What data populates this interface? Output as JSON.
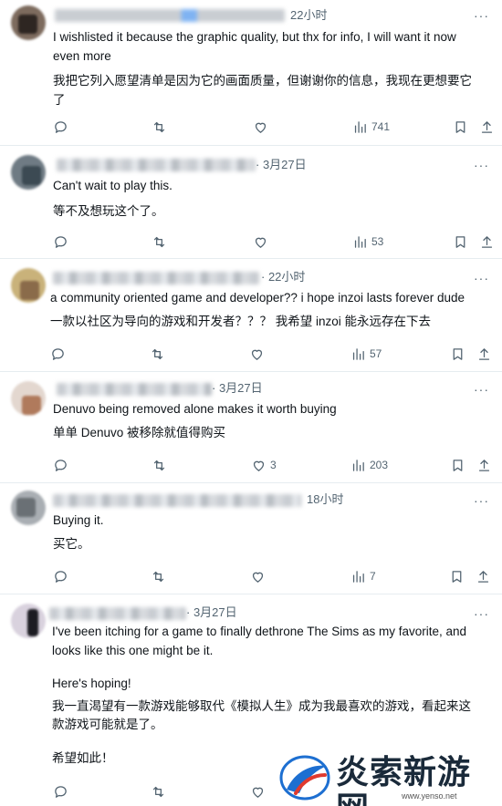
{
  "posts": [
    {
      "time": "22小时",
      "lines": [
        "I wishlisted it because the graphic quality, but thx for info, I will want it now",
        "even more",
        "",
        "我把它列入愿望清单是因为它的画面质量，但谢谢你的信息，我现在更想要它",
        "了"
      ],
      "views": "741",
      "likes": ""
    },
    {
      "time": "· 3月27日",
      "lines": [
        "Can't wait to play this.",
        "等不及想玩这个了。"
      ],
      "views": "53",
      "likes": ""
    },
    {
      "time": "· 22小时",
      "lines": [
        "a community oriented game and developer?? i hope inzoi lasts forever dude",
        "一款以社区为导向的游戏和开发者？？？ 我希望 inzoi 能永远存在下去"
      ],
      "views": "57",
      "likes": ""
    },
    {
      "time": "· 3月27日",
      "lines": [
        "Denuvo being removed alone makes it worth buying",
        "单单 Denuvo 被移除就值得购买"
      ],
      "views": "203",
      "likes": "3"
    },
    {
      "time": "18小时",
      "lines": [
        "Buying it.",
        "买它。"
      ],
      "views": "7",
      "likes": ""
    },
    {
      "time": "· 3月27日",
      "lines": [
        "I've been itching for a game to finally dethrone The Sims as my favorite, and",
        "looks like this one might be it.",
        "",
        "Here's hoping!",
        "我一直渴望有一款游戏能够取代《模拟人生》成为我最喜欢的游戏，看起来这",
        "款游戏可能就是了。",
        "",
        "希望如此！"
      ],
      "views": "",
      "likes": ""
    }
  ],
  "more_label": "···",
  "icons": [
    "reply-icon",
    "repost-icon",
    "like-icon",
    "views-icon",
    "bookmark-icon",
    "share-icon"
  ],
  "watermark": {
    "text": "炎索新游网",
    "url": "www.yenso.net"
  }
}
